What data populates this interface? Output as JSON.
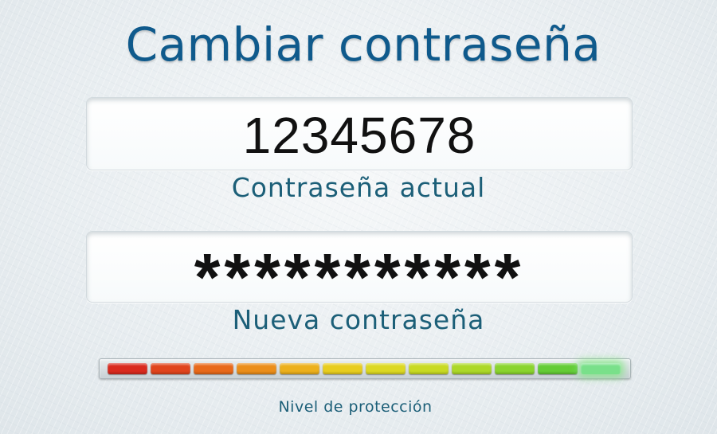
{
  "title": "Cambiar contraseña",
  "current_password": {
    "value": "12345678",
    "label": "Contraseña actual"
  },
  "new_password": {
    "value": "***********",
    "label": "Nueva contraseña"
  },
  "strength_meter": {
    "label": "Nivel de protección",
    "segments_total": 12,
    "level_fraction": 1.0,
    "segment_colors": [
      "#d92a1e",
      "#e0441c",
      "#e8691a",
      "#eb8e1a",
      "#ecb01c",
      "#e8cd1e",
      "#dcd822",
      "#c8da22",
      "#acd828",
      "#8ad42e",
      "#64cc36",
      "#79e08a"
    ]
  }
}
